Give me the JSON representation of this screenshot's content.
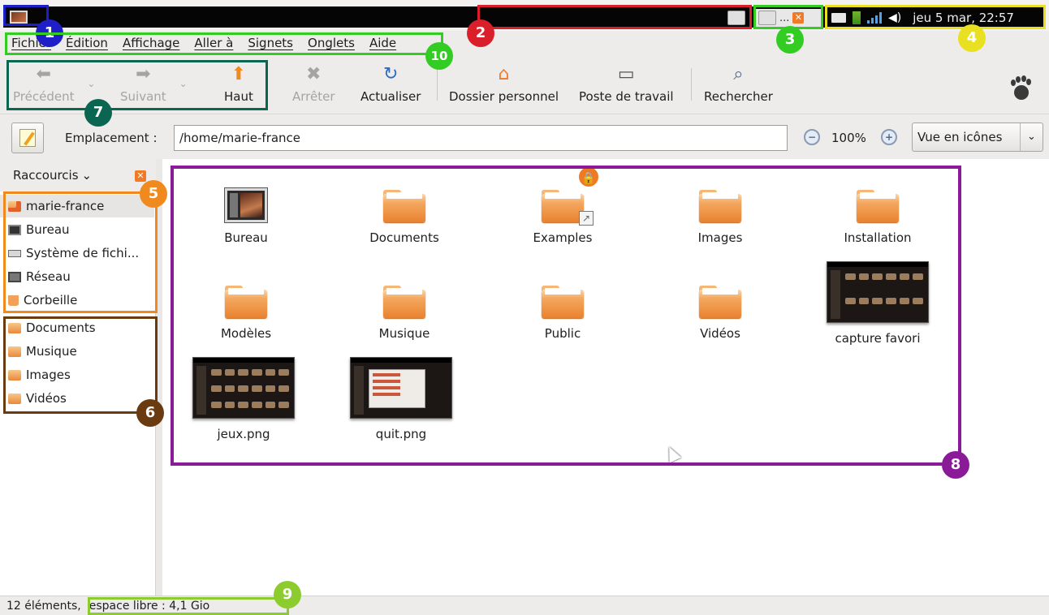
{
  "top_panel": {
    "clock": "jeu  5 mar, 22:57",
    "task_item_label": "..."
  },
  "menubar": {
    "items": [
      "Fichier",
      "Édition",
      "Affichage",
      "Aller à",
      "Signets",
      "Onglets",
      "Aide"
    ]
  },
  "toolbar": {
    "back": "Précédent",
    "forward": "Suivant",
    "up": "Haut",
    "stop": "Arrêter",
    "reload": "Actualiser",
    "home": "Dossier personnel",
    "computer": "Poste de travail",
    "search": "Rechercher"
  },
  "location": {
    "label": "Emplacement :",
    "value": "/home/marie-france",
    "zoom": "100%",
    "view_mode": "Vue en icônes"
  },
  "sidebar": {
    "header": "Raccourcis",
    "places": [
      {
        "label": "marie-france",
        "icon": "home-folder-icon"
      },
      {
        "label": "Bureau",
        "icon": "desktop-icon"
      },
      {
        "label": "Système de fichi...",
        "icon": "drive-icon"
      },
      {
        "label": "Réseau",
        "icon": "network-icon"
      },
      {
        "label": "Corbeille",
        "icon": "trash-icon"
      }
    ],
    "bookmarks": [
      {
        "label": "Documents",
        "icon": "folder-icon"
      },
      {
        "label": "Musique",
        "icon": "folder-icon"
      },
      {
        "label": "Images",
        "icon": "folder-icon"
      },
      {
        "label": "Vidéos",
        "icon": "folder-icon"
      }
    ]
  },
  "files": [
    {
      "label": "Bureau",
      "kind": "desktop"
    },
    {
      "label": "Documents",
      "kind": "folder"
    },
    {
      "label": "Examples",
      "kind": "folder-link-locked"
    },
    {
      "label": "Images",
      "kind": "folder"
    },
    {
      "label": "Installation",
      "kind": "folder"
    },
    {
      "label": "Modèles",
      "kind": "folder"
    },
    {
      "label": "Musique",
      "kind": "folder"
    },
    {
      "label": "Public",
      "kind": "folder"
    },
    {
      "label": "Vidéos",
      "kind": "folder"
    },
    {
      "label": "capture favori",
      "kind": "thumbnail"
    },
    {
      "label": "jeux.png",
      "kind": "thumbnail"
    },
    {
      "label": "quit.png",
      "kind": "thumbnail"
    }
  ],
  "status": {
    "count": "12 éléments,",
    "free": "espace libre : 4,1 Gio"
  },
  "annotations": {
    "n1": "1",
    "n2": "2",
    "n3": "3",
    "n4": "4",
    "n5": "5",
    "n6": "6",
    "n7": "7",
    "n8": "8",
    "n9": "9",
    "n10": "10"
  },
  "colors": {
    "annotation_blue": "#1f1fc8",
    "annotation_red": "#d9202a",
    "annotation_green": "#33cc22",
    "annotation_yellow": "#e8e020",
    "annotation_orange": "#f08a1e",
    "annotation_brown": "#6a3a10",
    "annotation_teal": "#0a6650",
    "annotation_purple": "#8a1a98",
    "annotation_lime": "#8ccc2e",
    "accent_orange": "#ef7a26"
  }
}
